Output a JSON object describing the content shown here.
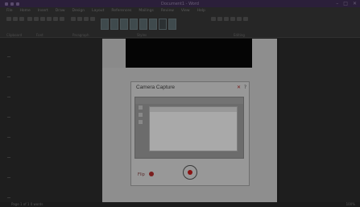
{
  "window": {
    "title": "Document1 - Word",
    "controls": [
      "–",
      "□",
      "✕"
    ]
  },
  "ribbon": {
    "tabs": [
      "File",
      "Home",
      "Insert",
      "Draw",
      "Design",
      "Layout",
      "References",
      "Mailings",
      "Review",
      "View",
      "Help"
    ],
    "groups": [
      "Clipboard",
      "Font",
      "Paragraph",
      "Styles",
      "Editing"
    ]
  },
  "camera_dialog": {
    "title": "Camera Capture",
    "close_icon": "close-icon",
    "help_icon": "help-icon",
    "flip_label": "Flip",
    "shutter_icon": "shutter-icon"
  },
  "statusbar": {
    "left": "Page 1 of 1   0 words",
    "right": "100%"
  },
  "colors": {
    "accent": "#7a1f1f",
    "titlebar": "#2b1f3a"
  }
}
